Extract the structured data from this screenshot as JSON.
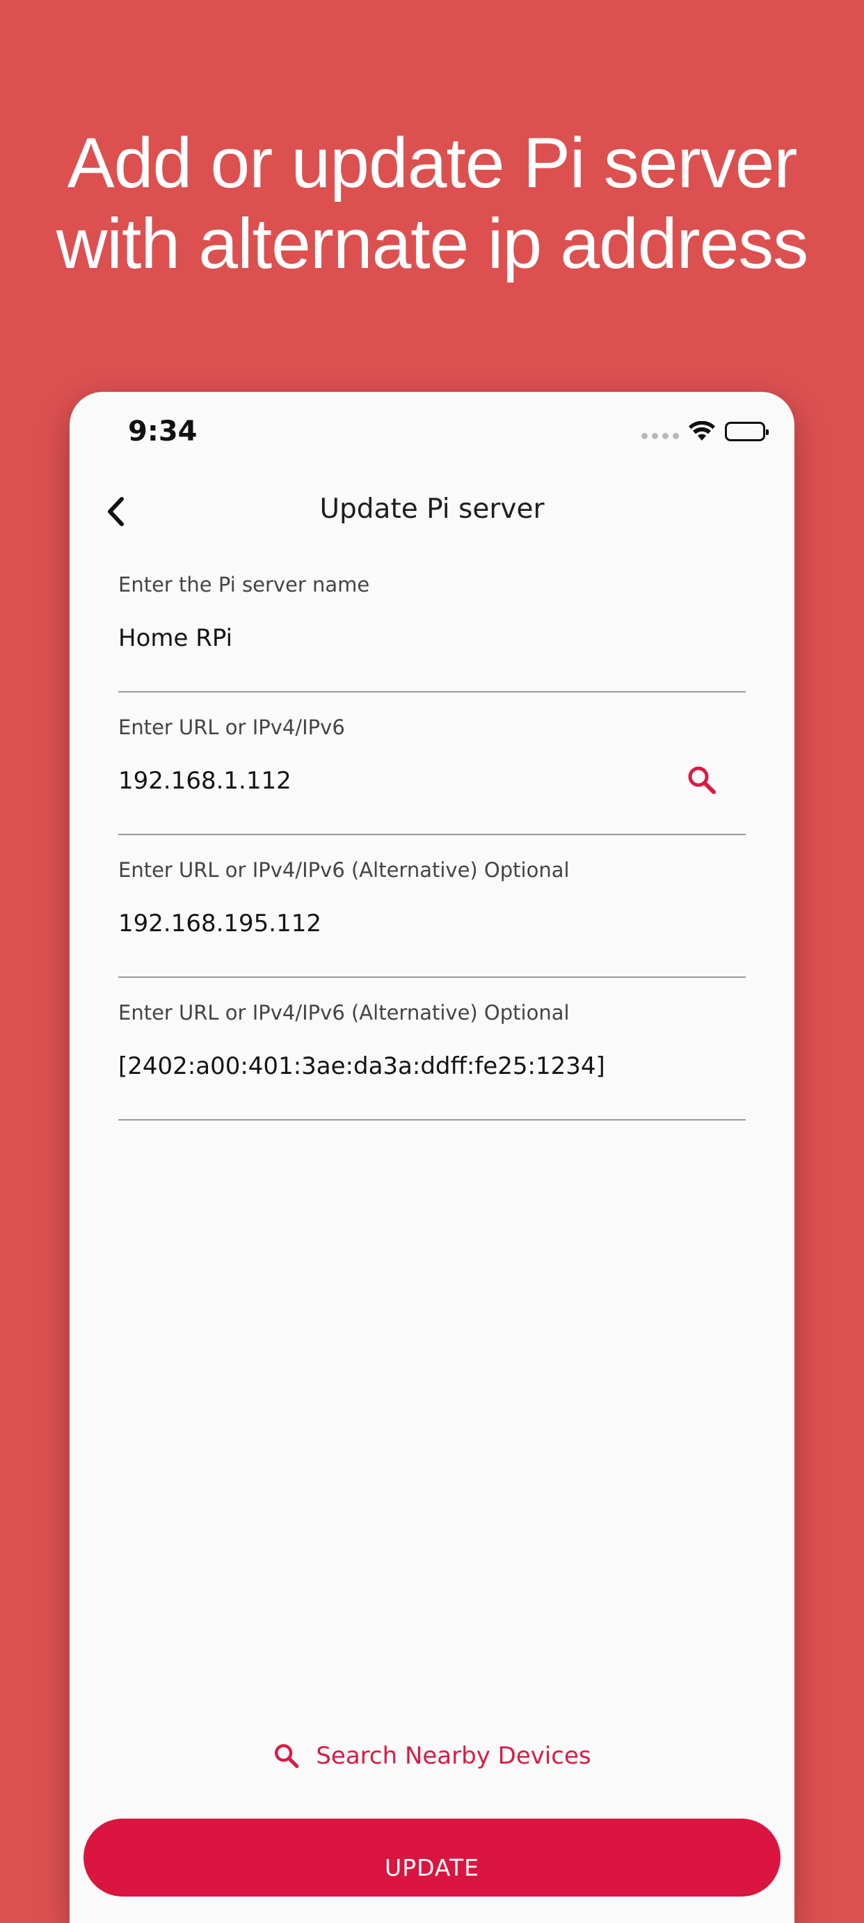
{
  "promo": {
    "line1": "Add or update Pi server",
    "line2": "with alternate ip address"
  },
  "status_bar": {
    "time": "9:34",
    "icons": [
      "signal-icon",
      "wifi-icon",
      "battery-icon"
    ]
  },
  "app_bar": {
    "title": "Update Pi server",
    "back_icon": "chevron-left-icon"
  },
  "form": {
    "fields": [
      {
        "label": "Enter the Pi server name",
        "value": "Home RPi"
      },
      {
        "label": "Enter URL or IPv4/IPv6",
        "value": "192.168.1.112",
        "icon": "search-icon"
      },
      {
        "label": "Enter URL or IPv4/IPv6 (Alternative) Optional",
        "value": "192.168.195.112"
      },
      {
        "label": "Enter URL or IPv4/IPv6 (Alternative) Optional",
        "value": "[2402:a00:401:3ae:da3a:ddff:fe25:1234]"
      }
    ]
  },
  "actions": {
    "search_nearby_label": "Search Nearby Devices",
    "search_nearby_icon": "search-icon",
    "update_label": "UPDATE"
  },
  "colors": {
    "background": "#DD5050",
    "accent": "#DA1540",
    "surface": "#FAFAFA"
  }
}
